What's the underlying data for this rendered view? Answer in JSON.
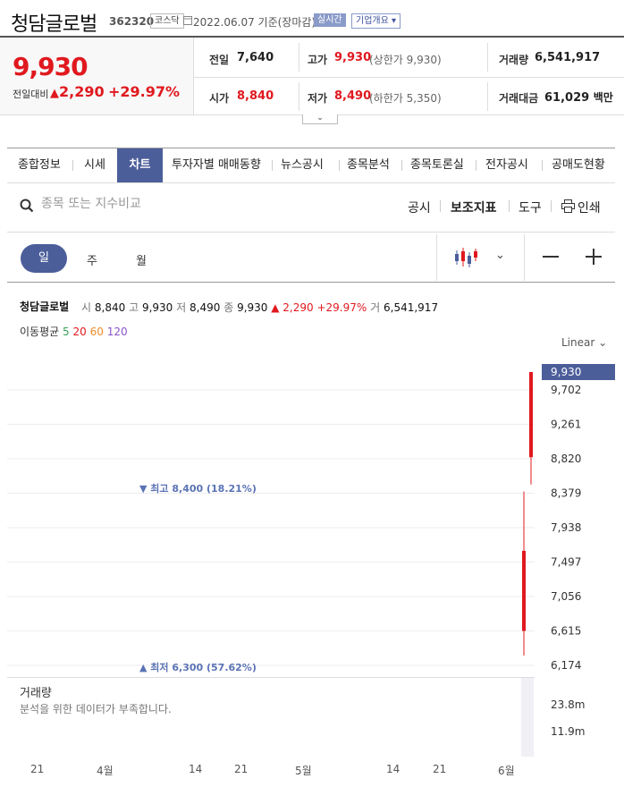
{
  "header": {
    "name": "청담글로벌",
    "code": "362320",
    "market": "코스닥",
    "date": "2022.06.07",
    "basis": "기준(장마감)",
    "realtime": "실시간",
    "company_info": "기업개요"
  },
  "price": {
    "current": "9,930",
    "change_label": "전일대비",
    "change": "2,290",
    "change_pct": "+29.97%"
  },
  "stats": {
    "prev_label": "전일",
    "prev": "7,640",
    "high_label": "고가",
    "high": "9,930",
    "high_sub": "(상한가 9,930)",
    "volume_label": "거래량",
    "volume": "6,541,917",
    "open_label": "시가",
    "open": "8,840",
    "low_label": "저가",
    "low": "8,490",
    "low_sub": "(하한가 5,350)",
    "amount_label": "거래대금",
    "amount": "61,029",
    "amount_unit": "백만"
  },
  "tabs": [
    "종합정보",
    "시세",
    "차트",
    "투자자별 매매동향",
    "뉴스공시",
    "종목분석",
    "종목토론실",
    "전자공시",
    "공매도현황"
  ],
  "active_tab": 2,
  "search": {
    "placeholder": "종목 또는 지수비교"
  },
  "tools": {
    "disclosure": "공시",
    "indicators": "보조지표",
    "tools": "도구",
    "print": "인쇄"
  },
  "periods": [
    "일",
    "주",
    "월"
  ],
  "chart_info": {
    "name": "청담글로벌",
    "o_k": "시",
    "o": "8,840",
    "h_k": "고",
    "h": "9,930",
    "l_k": "저",
    "l": "8,490",
    "c_k": "종",
    "c": "9,930",
    "chg": "▲ 2,290",
    "pct": "+29.97%",
    "v_k": "거",
    "v": "6,541,917"
  },
  "ma": {
    "label": "이동평균",
    "p5": "5",
    "p20": "20",
    "p60": "60",
    "p120": "120",
    "colors": [
      "#3aa35b",
      "#e0191f",
      "#f08c2a",
      "#8a55c9"
    ]
  },
  "scale": "Linear",
  "current_tag": "9,930",
  "markers": {
    "high": "▼ 최고 8,400 (18.21%)",
    "low": "▲ 최저 6,300 (57.62%)"
  },
  "volume": {
    "title": "거래량",
    "message": "분석을 위한 데이터가 부족합니다.",
    "ticks": [
      "23.8m",
      "11.9m"
    ]
  },
  "x_ticks": [
    "21",
    "4월",
    "14",
    "21",
    "5월",
    "14",
    "21",
    "6월"
  ],
  "chart_data": {
    "type": "candlestick",
    "y_ticks": [
      9702,
      9261,
      8820,
      8379,
      7938,
      7497,
      7056,
      6615,
      6174
    ],
    "y_tick_labels": [
      "9,702",
      "9,261",
      "8,820",
      "8,379",
      "7,938",
      "7,497",
      "7,056",
      "6,615",
      "6,174"
    ],
    "ylim": [
      6174,
      9930
    ],
    "candles": [
      {
        "open": 7640,
        "high": 8400,
        "low": 6300,
        "close": 6615
      },
      {
        "open": 8840,
        "high": 9930,
        "low": 8490,
        "close": 9930
      }
    ],
    "colors": {
      "up": "#e0191f",
      "accent": "#4c5e9a"
    }
  }
}
